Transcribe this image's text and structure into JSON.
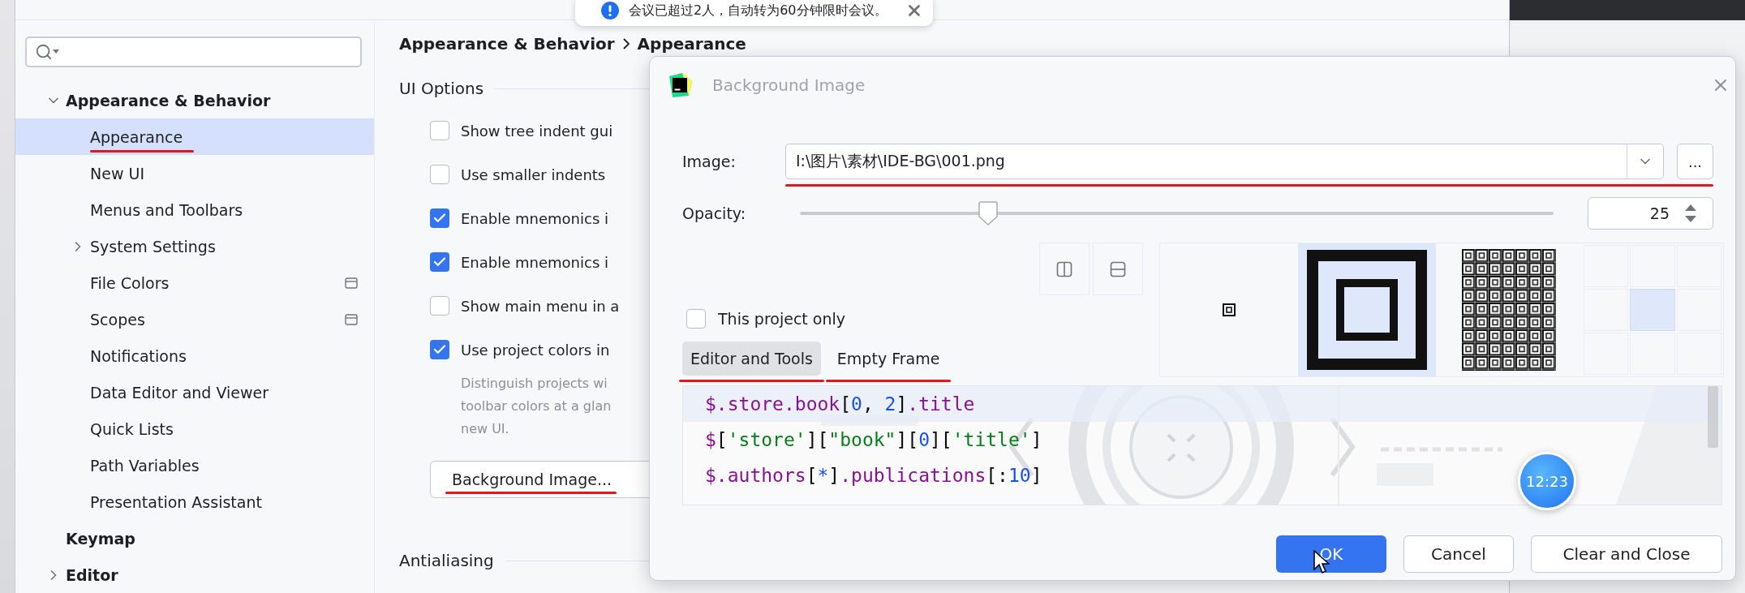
{
  "notification": {
    "text": "会议已超过2人，自动转为60分钟限时会议。"
  },
  "settings": {
    "sidebar": {
      "items": [
        {
          "label": "Appearance & Behavior",
          "kind": "folder",
          "expanded": true,
          "selected": false,
          "underlined": false,
          "children": [
            {
              "label": "Appearance",
              "kind": "leaf",
              "selected": true,
              "underlined": true,
              "scoped": false
            },
            {
              "label": "New UI",
              "kind": "leaf",
              "selected": false,
              "underlined": false,
              "scoped": false
            },
            {
              "label": "Menus and Toolbars",
              "kind": "leaf",
              "selected": false,
              "underlined": false,
              "scoped": false
            },
            {
              "label": "System Settings",
              "kind": "folder",
              "expanded": false,
              "selected": false,
              "underlined": false,
              "scoped": false
            },
            {
              "label": "File Colors",
              "kind": "leaf",
              "selected": false,
              "underlined": false,
              "scoped": true
            },
            {
              "label": "Scopes",
              "kind": "leaf",
              "selected": false,
              "underlined": false,
              "scoped": true
            },
            {
              "label": "Notifications",
              "kind": "leaf",
              "selected": false,
              "underlined": false,
              "scoped": false
            },
            {
              "label": "Data Editor and Viewer",
              "kind": "leaf",
              "selected": false,
              "underlined": false,
              "scoped": false
            },
            {
              "label": "Quick Lists",
              "kind": "leaf",
              "selected": false,
              "underlined": false,
              "scoped": false
            },
            {
              "label": "Path Variables",
              "kind": "leaf",
              "selected": false,
              "underlined": false,
              "scoped": false
            },
            {
              "label": "Presentation Assistant",
              "kind": "leaf",
              "selected": false,
              "underlined": false,
              "scoped": false
            }
          ]
        },
        {
          "label": "Keymap",
          "kind": "leaf",
          "selected": false,
          "underlined": false
        },
        {
          "label": "Editor",
          "kind": "folder",
          "expanded": false,
          "selected": false,
          "underlined": false
        }
      ]
    },
    "breadcrumb": [
      "Appearance & Behavior",
      "Appearance"
    ],
    "section_title": "UI Options",
    "options": [
      {
        "label": "Show tree indent gui",
        "checked": false
      },
      {
        "label": "Use smaller indents",
        "checked": false
      },
      {
        "label": "Enable mnemonics i",
        "checked": true
      },
      {
        "label": "Enable mnemonics i",
        "checked": true
      },
      {
        "label": "Show main menu in a",
        "checked": false
      },
      {
        "label": "Use project colors in",
        "checked": true
      }
    ],
    "description": [
      "Distinguish projects wi",
      "toolbar colors at a glan",
      "new UI."
    ],
    "background_button": {
      "label": "Background Image...",
      "underlined": true
    },
    "next_section_title": "Antialiasing"
  },
  "dialog": {
    "title": "Background Image",
    "image": {
      "label": "Image:",
      "value": "I:\\图片\\素材\\IDE-BG\\001.png",
      "browse": "...",
      "underlined": true
    },
    "opacity": {
      "label": "Opacity:",
      "level": 0.25,
      "value": "25"
    },
    "fill_modes": [
      {
        "kind": "center",
        "selected": false
      },
      {
        "kind": "stretch",
        "selected": true
      },
      {
        "kind": "tile",
        "selected": false
      }
    ],
    "anchors": [
      {
        "selected": false
      },
      {
        "selected": false
      },
      {
        "selected": false
      },
      {
        "selected": false
      },
      {
        "selected": true
      },
      {
        "selected": false
      },
      {
        "selected": false
      },
      {
        "selected": false
      },
      {
        "selected": false
      }
    ],
    "this_project_only": {
      "label": "This project only",
      "checked": false
    },
    "tabs": [
      {
        "label": "Editor and Tools",
        "selected": true,
        "underlined": true
      },
      {
        "label": "Empty Frame",
        "selected": false,
        "underlined": true
      }
    ],
    "code_lines": [
      [
        {
          "text": "$",
          "kind": "sym"
        },
        {
          "text": ".store.book",
          "kind": "field"
        },
        {
          "text": "[",
          "kind": "punct"
        },
        {
          "text": "0",
          "kind": "num"
        },
        {
          "text": ", ",
          "kind": "punct"
        },
        {
          "text": "2",
          "kind": "num"
        },
        {
          "text": "]",
          "kind": "punct"
        },
        {
          "text": ".title",
          "kind": "field"
        }
      ],
      [
        {
          "text": "$",
          "kind": "sym"
        },
        {
          "text": "[",
          "kind": "punct"
        },
        {
          "text": "'store'",
          "kind": "str"
        },
        {
          "text": "][",
          "kind": "punct"
        },
        {
          "text": "\"book\"",
          "kind": "str"
        },
        {
          "text": "][",
          "kind": "punct"
        },
        {
          "text": "0",
          "kind": "num"
        },
        {
          "text": "][",
          "kind": "punct"
        },
        {
          "text": "'title'",
          "kind": "str"
        },
        {
          "text": "]",
          "kind": "punct"
        }
      ],
      [
        {
          "text": "$",
          "kind": "sym"
        },
        {
          "text": ".authors",
          "kind": "field"
        },
        {
          "text": "[",
          "kind": "punct"
        },
        {
          "text": "*",
          "kind": "num"
        },
        {
          "text": "]",
          "kind": "punct"
        },
        {
          "text": ".publications",
          "kind": "field"
        },
        {
          "text": "[:",
          "kind": "punct"
        },
        {
          "text": "10",
          "kind": "num"
        },
        {
          "text": "]",
          "kind": "punct"
        }
      ]
    ],
    "buttons": [
      {
        "label": "OK",
        "kind": "primary"
      },
      {
        "label": "Cancel",
        "kind": "normal"
      },
      {
        "label": "Clear and Close",
        "kind": "normal"
      }
    ]
  },
  "clock_widget": {
    "time": "12:23"
  }
}
